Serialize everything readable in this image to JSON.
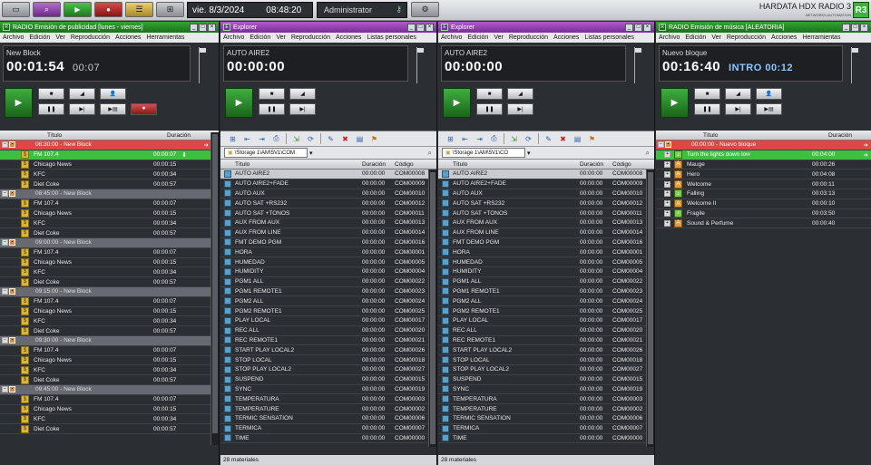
{
  "topbar": {
    "date": "vie. 8/3/2024",
    "time": "08:48:20",
    "user": "Administrator",
    "brand": "HARDATA HDX RADIO 3",
    "brand_sub": "NETWORKS AUTOMATION",
    "logo": "R3"
  },
  "panels": {
    "ads": {
      "title": "RADIO Emisión de publicidad [lunes - viernes]",
      "menu": [
        "Archivo",
        "Edición",
        "Ver",
        "Reproducción",
        "Acciones",
        "Herramientas"
      ],
      "display_name": "New Block",
      "display_time": "00:01:54",
      "display_sub": "00:07",
      "col_title": "Título",
      "col_duration": "Duración",
      "blocks": [
        {
          "time": "08:30:00 - New Block",
          "items": [
            {
              "t": "FM 107.4",
              "d": "00:00:07"
            },
            {
              "t": "Chicago News",
              "d": "00:00:15"
            },
            {
              "t": "KFC",
              "d": "00:00:34"
            },
            {
              "t": "Diet Coke",
              "d": "00:00:57"
            }
          ]
        },
        {
          "time": "08:45:00 - New Block",
          "items": [
            {
              "t": "FM 107.4",
              "d": "00:00:07"
            },
            {
              "t": "Chicago News",
              "d": "00:00:15"
            },
            {
              "t": "KFC",
              "d": "00:00:34"
            },
            {
              "t": "Diet Coke",
              "d": "00:00:57"
            }
          ]
        },
        {
          "time": "09:00:00 - New Block",
          "items": [
            {
              "t": "FM 107.4",
              "d": "00:00:07"
            },
            {
              "t": "Chicago News",
              "d": "00:00:15"
            },
            {
              "t": "KFC",
              "d": "00:00:34"
            },
            {
              "t": "Diet Coke",
              "d": "00:00:57"
            }
          ]
        },
        {
          "time": "09:15:00 - New Block",
          "items": [
            {
              "t": "FM 107.4",
              "d": "00:00:07"
            },
            {
              "t": "Chicago News",
              "d": "00:00:15"
            },
            {
              "t": "KFC",
              "d": "00:00:34"
            },
            {
              "t": "Diet Coke",
              "d": "00:00:57"
            }
          ]
        },
        {
          "time": "09:30:00 - New Block",
          "items": [
            {
              "t": "FM 107.4",
              "d": "00:00:07"
            },
            {
              "t": "Chicago News",
              "d": "00:00:15"
            },
            {
              "t": "KFC",
              "d": "00:00:34"
            },
            {
              "t": "Diet Coke",
              "d": "00:00:57"
            }
          ]
        },
        {
          "time": "09:45:00 - New Block",
          "items": [
            {
              "t": "FM 107.4",
              "d": "00:00:07"
            },
            {
              "t": "Chicago News",
              "d": "00:00:15"
            },
            {
              "t": "KFC",
              "d": "00:00:34"
            },
            {
              "t": "Diet Coke",
              "d": "00:00:57"
            }
          ]
        }
      ]
    },
    "explorer1": {
      "title": "Explorer",
      "menu": [
        "Archivo",
        "Edición",
        "Ver",
        "Reproducción",
        "Acciones",
        "Listas personales"
      ],
      "display_name": "AUTO AIRE2",
      "display_time": "00:00:00",
      "path": "\\Storage 1\\AM\\5V1\\COM",
      "cols": {
        "title": "Título",
        "duration": "Duración",
        "code": "Código"
      },
      "status": "28 materiales"
    },
    "explorer2": {
      "title": "Explorer",
      "menu": [
        "Archivo",
        "Edición",
        "Ver",
        "Reproducción",
        "Acciones",
        "Listas personales"
      ],
      "display_name": "AUTO AIRE2",
      "display_time": "00:00:00",
      "path": "\\Storage 1\\AM\\5V1\\CO",
      "cols": {
        "title": "Título",
        "duration": "Duración",
        "code": "Código"
      },
      "status": "28 materiales"
    },
    "music": {
      "title": "RADIO Emisión de música [ALEATORIA]",
      "menu": [
        "Archivo",
        "Edición",
        "Ver",
        "Reproducción",
        "Acciones",
        "Herramientas"
      ],
      "display_name": "Nuevo bloque",
      "display_time": "00:16:40",
      "display_intro": "INTRO 00:12",
      "col_title": "Título",
      "col_duration": "Duración",
      "block": "00:00:00 - Nuevo bloque",
      "items": [
        {
          "t": "Turn the lights down low",
          "d": "00:04:00",
          "c": "gr"
        },
        {
          "t": "Mauge",
          "d": "00:00:26",
          "c": "or"
        },
        {
          "t": "Hero",
          "d": "00:04:08",
          "c": "or"
        },
        {
          "t": "Welcome",
          "d": "00:00:11",
          "c": "or"
        },
        {
          "t": "Falling",
          "d": "00:03:13",
          "c": "gr"
        },
        {
          "t": "Welcome II",
          "d": "00:00:10",
          "c": "or"
        },
        {
          "t": "Fragile",
          "d": "00:03:50",
          "c": "gr"
        },
        {
          "t": "Sound & Perfume",
          "d": "00:00:40",
          "c": "or"
        }
      ]
    }
  },
  "materials": [
    {
      "t": "AUTO AIRE2",
      "d": "00:00:00",
      "c": "COM00008"
    },
    {
      "t": "AUTO AIRE2+FADE",
      "d": "00:00:00",
      "c": "COM00009"
    },
    {
      "t": "AUTO AUX",
      "d": "00:00:00",
      "c": "COM00010"
    },
    {
      "t": "AUTO SAT +RS232",
      "d": "00:00:00",
      "c": "COM00012"
    },
    {
      "t": "AUTO SAT +TONOS",
      "d": "00:00:00",
      "c": "COM00011"
    },
    {
      "t": "AUX FROM AUX",
      "d": "00:00:00",
      "c": "COM00013"
    },
    {
      "t": "AUX FROM LINE",
      "d": "00:00:00",
      "c": "COM00014"
    },
    {
      "t": "FMT DEMO PGM",
      "d": "00:00:00",
      "c": "COM00016"
    },
    {
      "t": "HORA",
      "d": "00:00:00",
      "c": "COM00001"
    },
    {
      "t": "HUMEDAD",
      "d": "00:00:00",
      "c": "COM00005"
    },
    {
      "t": "HUMIDITY",
      "d": "00:00:00",
      "c": "COM00004"
    },
    {
      "t": "PGM1 ALL",
      "d": "00:00:00",
      "c": "COM00022"
    },
    {
      "t": "PGM1 REMOTE1",
      "d": "00:00:00",
      "c": "COM00023"
    },
    {
      "t": "PGM2 ALL",
      "d": "00:00:00",
      "c": "COM00024"
    },
    {
      "t": "PGM2 REMOTE1",
      "d": "00:00:00",
      "c": "COM00025"
    },
    {
      "t": "PLAY LOCAL",
      "d": "00:00:00",
      "c": "COM00017"
    },
    {
      "t": "REC ALL",
      "d": "00:00:00",
      "c": "COM00020"
    },
    {
      "t": "REC REMOTE1",
      "d": "00:00:00",
      "c": "COM00021"
    },
    {
      "t": "START PLAY LOCAL2",
      "d": "00:00:00",
      "c": "COM00026"
    },
    {
      "t": "STOP LOCAL",
      "d": "00:00:00",
      "c": "COM00018"
    },
    {
      "t": "STOP PLAY LOCAL2",
      "d": "00:00:00",
      "c": "COM00027"
    },
    {
      "t": "SUSPEND",
      "d": "00:00:00",
      "c": "COM00015"
    },
    {
      "t": "SYNC",
      "d": "00:00:00",
      "c": "COM00019"
    },
    {
      "t": "TEMPERATURA",
      "d": "00:00:00",
      "c": "COM00003"
    },
    {
      "t": "TEMPERATURE",
      "d": "00:00:00",
      "c": "COM00002"
    },
    {
      "t": "TERMIC SENSATION",
      "d": "00:00:00",
      "c": "COM00006"
    },
    {
      "t": "TERMICA",
      "d": "00:00:00",
      "c": "COM00007"
    },
    {
      "t": "TIME",
      "d": "00:00:00",
      "c": "COM00000"
    }
  ]
}
